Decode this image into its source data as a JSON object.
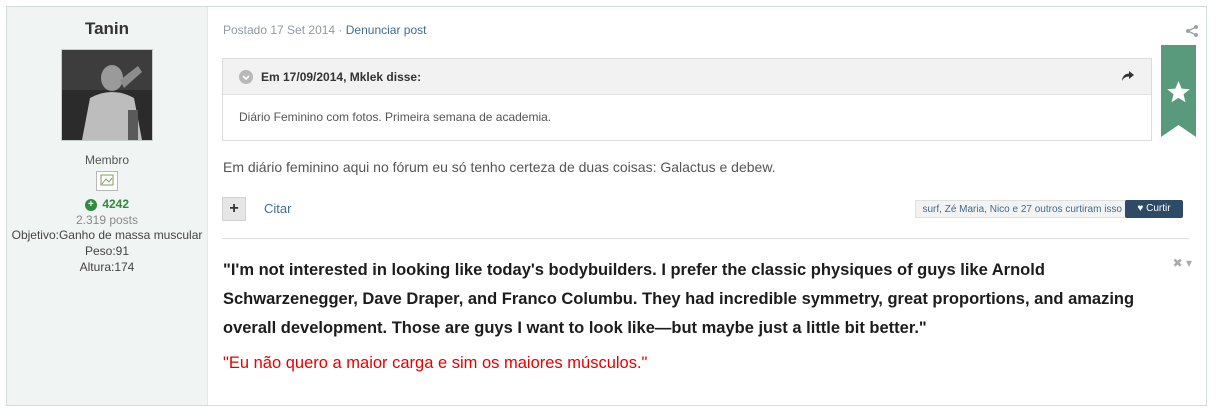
{
  "author": {
    "name": "Tanin",
    "rank": "Membro",
    "reputation": "4242",
    "posts": "2.319 posts",
    "fields": [
      "Objetivo:Ganho de massa muscular",
      "Peso:91",
      "Altura:174"
    ]
  },
  "post": {
    "date": "Postado 17 Set 2014",
    "separator": " · ",
    "report": "Denunciar post",
    "quote_cite": "Em 17/09/2014, Mklek disse:",
    "quote_text": "Diário Feminino com fotos. Primeira semana de academia.",
    "text": "Em diário feminino aqui no fórum eu só tenho certeza de duas coisas: Galactus e debew.",
    "quote_button": "Citar",
    "likes_text": "surf, Zé Maria, Nico e 27 outros curtiram isso",
    "like_button": "Curtir"
  },
  "signature": {
    "english": "\"I'm not interested in looking like today's bodybuilders. I prefer the classic physiques of guys like Arnold Schwarzenegger, Dave Draper, and Franco Columbu. They had incredible symmetry, great proportions, and amazing overall development. Those are guys I want to look like—but maybe just a little bit better.\"",
    "portuguese": "\"Eu não quero a maior carga e sim os maiores músculos.\"",
    "close_label": "✖ ▾"
  },
  "colors": {
    "accent_link": "#3f6d8f",
    "reputation_green": "#2e8b3f",
    "ribbon_green": "#5a9a7c",
    "signature_red": "#e60000",
    "like_button_bg": "#2d4a66"
  }
}
